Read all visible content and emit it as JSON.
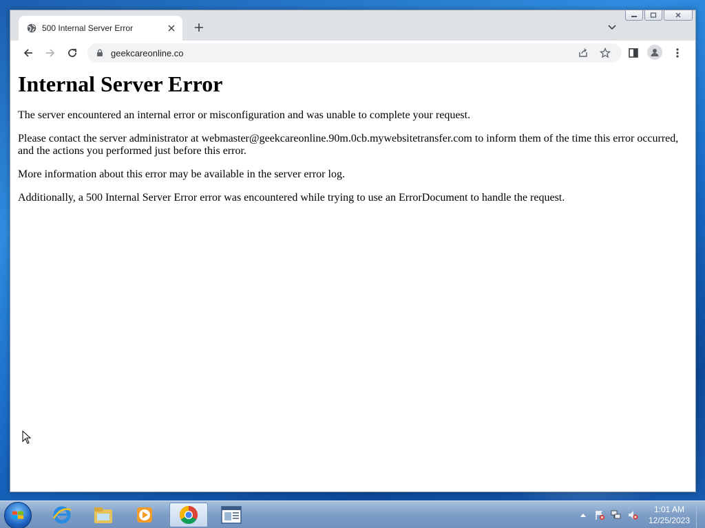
{
  "browser": {
    "tab_title": "500 Internal Server Error",
    "url": "geekcareonline.co"
  },
  "page": {
    "heading": "Internal Server Error",
    "paragraphs": [
      "The server encountered an internal error or misconfiguration and was unable to complete your request.",
      "Please contact the server administrator at webmaster@geekcareonline.90m.0cb.mywebsitetransfer.com to inform them of the time this error occurred, and the actions you performed just before this error.",
      "More information about this error may be available in the server error log.",
      "Additionally, a 500 Internal Server Error error was encountered while trying to use an ErrorDocument to handle the request."
    ]
  },
  "taskbar": {
    "apps": [
      "internet-explorer",
      "windows-explorer",
      "media-player",
      "chrome",
      "other-app"
    ],
    "clock_time": "1:01 AM",
    "clock_date": "12/25/2023"
  },
  "colors": {
    "accent_blue": "#1a73e8",
    "tab_bg": "#dee1e6"
  }
}
